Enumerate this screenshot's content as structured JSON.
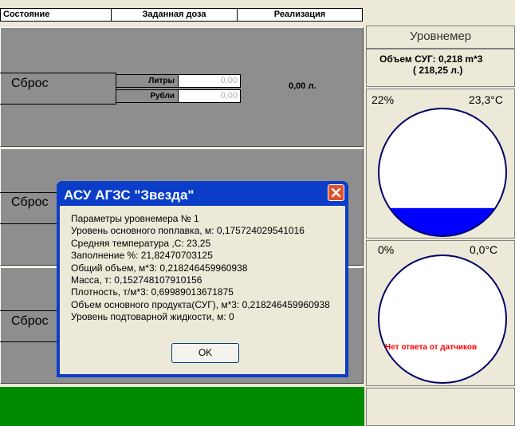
{
  "header": {
    "col_state": "Состояние",
    "col_dose": "Заданная доза",
    "col_realization": "Реализация"
  },
  "rows": [
    {
      "reset_label": "Сброс",
      "liters_label": "Литры",
      "liters_value": "0,00",
      "rubles_label": "Рубли",
      "rubles_value": "0,00",
      "total": "0,00 л."
    },
    {
      "reset_label": "Сброс"
    },
    {
      "reset_label": "Сброс"
    }
  ],
  "level_meter": {
    "title": "Уровнемер",
    "volume_line1": "Объем СУГ: 0,218 m*3",
    "volume_line2": "( 218,25 л.)",
    "gauge1": {
      "fill_percent": "22%",
      "temperature": "23,3°С",
      "fill_fraction": 0.22
    },
    "gauge2": {
      "fill_percent": "0%",
      "temperature": "0,0°С",
      "message": "Нет ответа от  датчиков"
    }
  },
  "dialog": {
    "title": "АСУ АГЗС \"Звезда\"",
    "lines": [
      "Параметры уровнемера № 1",
      "Уровень основного поплавка, м: 0,175724029541016",
      "Средняя температура ,С: 23,25",
      "Заполнение %: 21,82470703125",
      "Общий объем, м*3: 0,218246459960938",
      "Масса, т: 0,152748107910156",
      "Плотность, т/м*3: 0,69989013671875",
      "Объем основного продукта(СУГ), м*3: 0,218246459960938",
      "Уровень подтоварной жидкости, м: 0"
    ],
    "ok_label": "OK"
  },
  "colors": {
    "panel": "#8e8e8e",
    "fill": "#0000ff",
    "status_bar": "#008a00",
    "dialog_frame": "#0a3ec9",
    "error_text": "#ff0000"
  }
}
